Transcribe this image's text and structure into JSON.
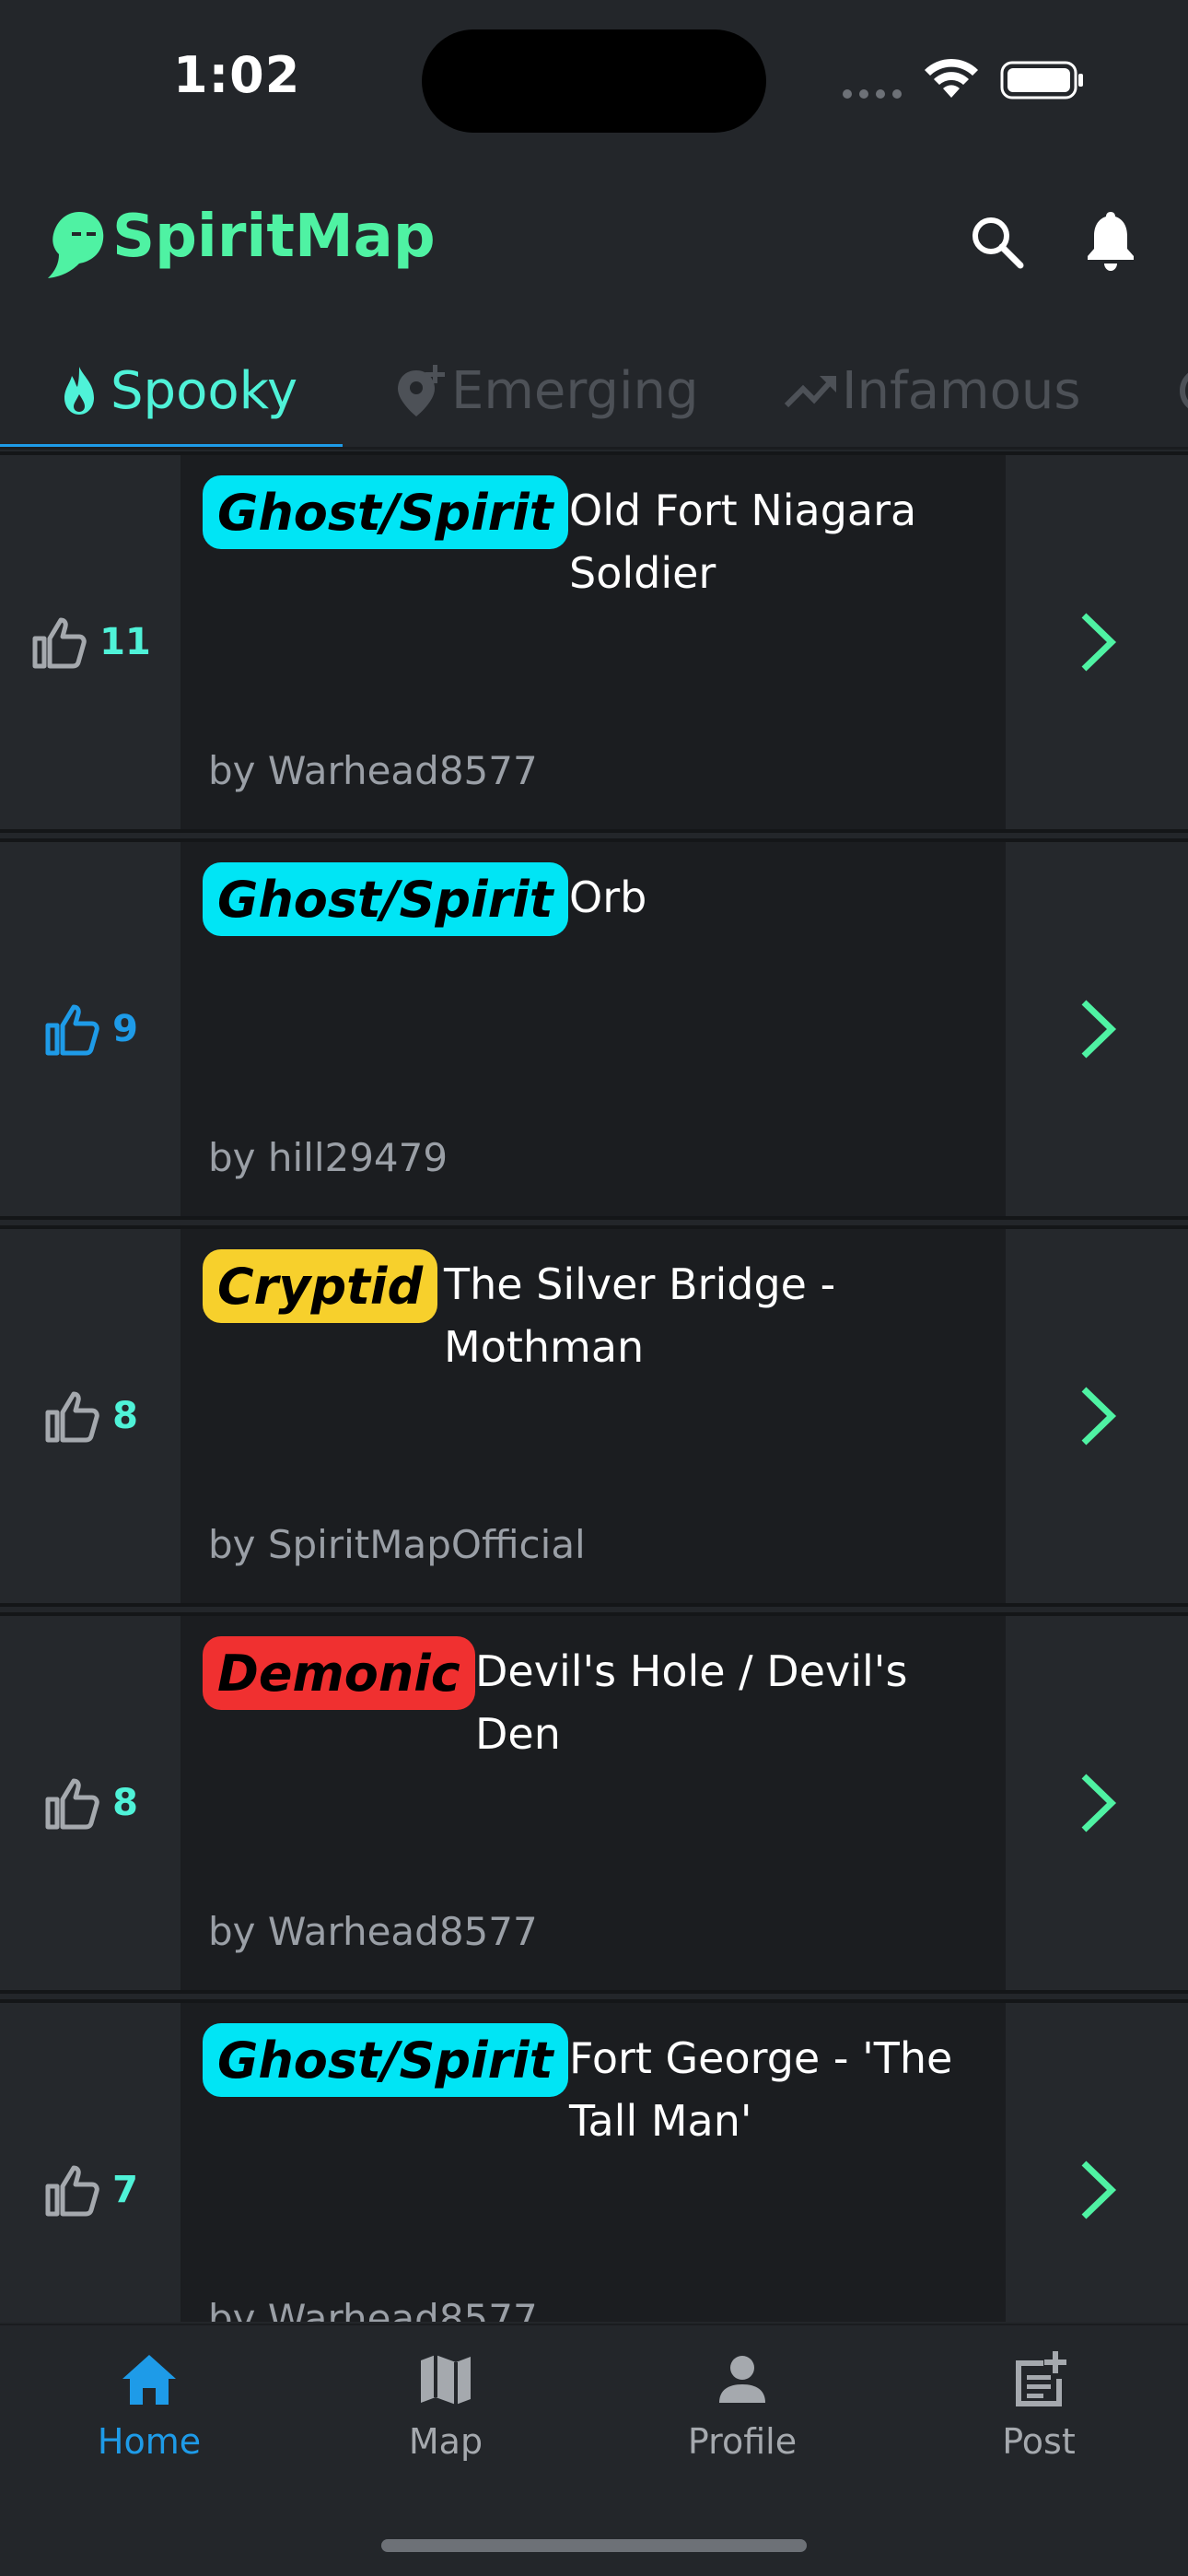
{
  "status_bar": {
    "time": "1:02"
  },
  "app": {
    "name": "SpiritMap",
    "accent": "#4ff2a3"
  },
  "tabs": [
    {
      "label": "Spooky",
      "icon": "flame-icon",
      "active": true
    },
    {
      "label": "Emerging",
      "icon": "location-add-icon",
      "active": false
    },
    {
      "label": "Infamous",
      "icon": "trending-up-icon",
      "active": false
    }
  ],
  "posts": [
    {
      "votes": "11",
      "liked": false,
      "tag": "Ghost/Spirit",
      "tag_color": "#00e5f5",
      "title_line1": "Old Fort Niagara",
      "title_line2": "Soldier",
      "author": "by Warhead8577"
    },
    {
      "votes": "9",
      "liked": true,
      "tag": "Ghost/Spirit",
      "tag_color": "#00e5f5",
      "title_line1": "Orb",
      "title_line2": "",
      "author": "by hill29479"
    },
    {
      "votes": "8",
      "liked": false,
      "tag": "Cryptid",
      "tag_color": "#f7d02c",
      "title_line1": "The Silver Bridge -",
      "title_line2": "Mothman",
      "author": "by SpiritMapOfficial"
    },
    {
      "votes": "8",
      "liked": false,
      "tag": "Demonic",
      "tag_color": "#f03030",
      "title_line1": "Devil's Hole / Devil's",
      "title_line2": "Den",
      "author": "by Warhead8577"
    },
    {
      "votes": "7",
      "liked": false,
      "tag": "Ghost/Spirit",
      "tag_color": "#00e5f5",
      "title_line1": "Fort George - 'The",
      "title_line2": "Tall Man'",
      "author": "by Warhead8577"
    }
  ],
  "bottom_nav": [
    {
      "label": "Home",
      "icon": "home-icon",
      "active": true
    },
    {
      "label": "Map",
      "icon": "map-icon",
      "active": false
    },
    {
      "label": "Profile",
      "icon": "profile-icon",
      "active": false
    },
    {
      "label": "Post",
      "icon": "post-add-icon",
      "active": false
    }
  ]
}
